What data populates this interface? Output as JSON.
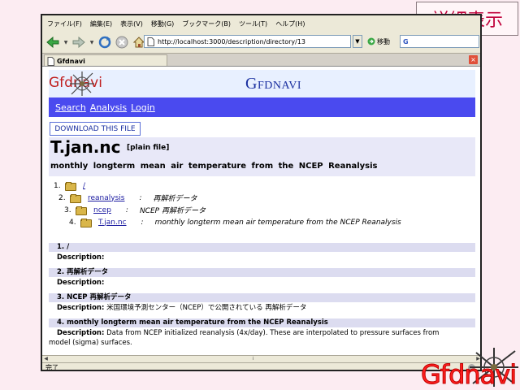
{
  "slide": {
    "title": "詳細表示",
    "corner_logo_text": "Gfdnavi"
  },
  "browser": {
    "menu": [
      "ファイル(F)",
      "編集(E)",
      "表示(V)",
      "移動(G)",
      "ブックマーク(B)",
      "ツール(T)",
      "ヘルプ(H)"
    ],
    "url": "http://localhost:3000/description/directory/13",
    "go_label": "移動",
    "search_placeholder": "G",
    "tab_title": "Gfdnavi",
    "status_text": "完了"
  },
  "page": {
    "logo_text": "Gfdnavi",
    "site_title": "Gfdnavi",
    "nav": [
      "Search",
      "Analysis",
      "Login"
    ],
    "download_label": "DOWNLOAD THIS FILE",
    "file_name": "T.jan.nc",
    "file_type": "[plain file]",
    "file_description": "monthly longterm mean air temperature from the NCEP Reanalysis",
    "tree": [
      {
        "num": "1.",
        "link": "/",
        "sep": "",
        "desc": ""
      },
      {
        "num": "2.",
        "link": "reanalysis",
        "sep": ":",
        "desc": "再解析データ"
      },
      {
        "num": "3.",
        "link": "ncep",
        "sep": ":",
        "desc": "NCEP 再解析データ"
      },
      {
        "num": "4.",
        "link": "T.jan.nc",
        "sep": ":",
        "desc": "monthly longterm mean air temperature from the NCEP Reanalysis"
      }
    ],
    "sections": [
      {
        "heading": "1. /",
        "label": "Description:",
        "text": ""
      },
      {
        "heading": "2. 再解析データ",
        "label": "Description:",
        "text": ""
      },
      {
        "heading": "3. NCEP 再解析データ",
        "label": "Description:",
        "text": "米国環境予測センター（NCEP）で公開されている 再解析データ"
      },
      {
        "heading": "4. monthly longterm mean air temperature from the NCEP Reanalysis",
        "label": "Description:",
        "text": "Data from NCEP initialized reanalysis (4x/day). These are interpolated to pressure surfaces from model (sigma) surfaces."
      }
    ]
  },
  "colors": {
    "navbar": "#4a4aef",
    "site_title": "#1a2fa0",
    "slide_title": "#c0003a",
    "logo": "#c02020"
  }
}
